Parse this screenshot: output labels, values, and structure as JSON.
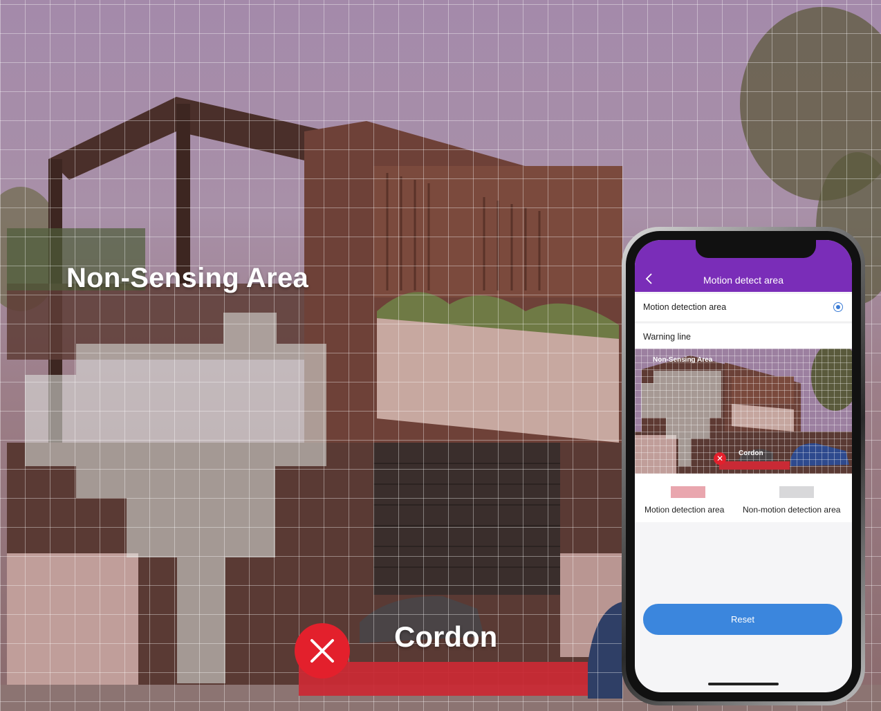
{
  "overlay": {
    "non_sensing_label": "Non-Sensing Area",
    "cordon_label": "Cordon",
    "cordon_color": "#c92a35",
    "close_icon": "close-icon"
  },
  "phone": {
    "app_bar": {
      "title": "Motion detect area",
      "back_icon": "chevron-left-icon",
      "color": "#7a2db8"
    },
    "options": [
      {
        "label": "Motion detection area",
        "selected": true
      },
      {
        "label": "Warning line",
        "selected": false
      }
    ],
    "preview": {
      "non_sensing_label": "Non-Sensing Area",
      "cordon_label": "Cordon"
    },
    "legend": [
      {
        "label": "Motion detection area",
        "color": "#e9a6ae"
      },
      {
        "label": "Non-motion detection area",
        "color": "#d8d8da"
      }
    ],
    "reset_label": "Reset",
    "accent": "#3b86dd"
  }
}
